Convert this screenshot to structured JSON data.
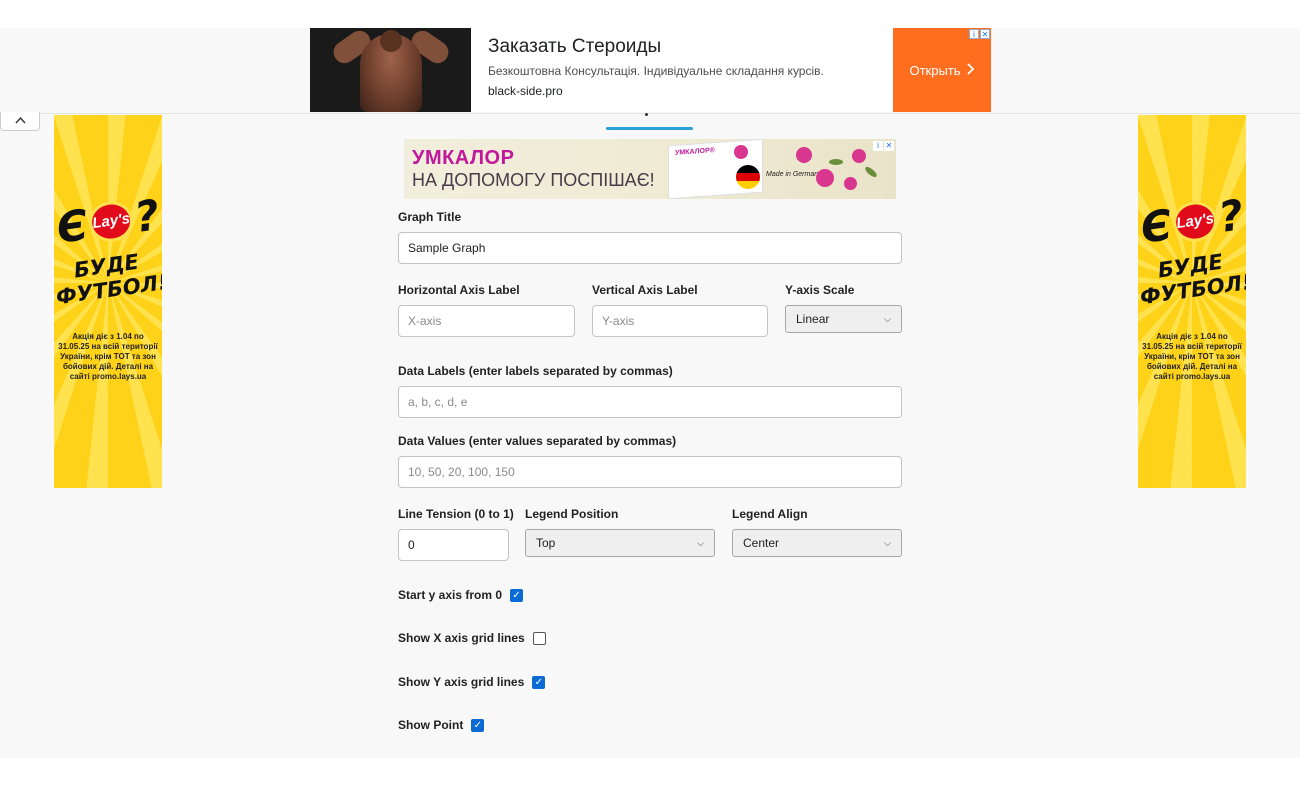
{
  "top_ad": {
    "title": "Заказать Стероиды",
    "description": "Безкоштовна Консультація. Індивідуальне складання курсів.",
    "domain": "black-side.pro",
    "cta": "Открыть",
    "cta_icon": "chevron-right",
    "cta_color": "#ff6d1f"
  },
  "collapse_icon": "^",
  "side_ad": {
    "line1": "Є",
    "brand": "Lay's",
    "q": "?",
    "slogan1": "БУДЕ",
    "slogan2": "ФУТБОЛ!",
    "fine_print": "Акція діє з 1.04 по 31.05.25 на всій території України, крім ТОТ та зон бойових дій. Деталі на сайті promo.lays.ua",
    "bg_color": "#ffd21a"
  },
  "mid_ad": {
    "brand": "УМКАЛОР",
    "tagline": "НА ДОПОМОГУ ПОСПІШАЄ!",
    "box_brand": "УМКАЛОР®",
    "made_in": "Made in Germany"
  },
  "form": {
    "title_label": "Graph Title",
    "title_value": "Sample Graph",
    "x_label": "Horizontal Axis Label",
    "x_placeholder": "X-axis",
    "y_label": "Vertical Axis Label",
    "y_placeholder": "Y-axis",
    "scale_label": "Y-axis Scale",
    "scale_value": "Linear",
    "labels_label": "Data Labels (enter labels separated by commas)",
    "labels_placeholder": "a, b, c, d, e",
    "values_label": "Data Values (enter values separated by commas)",
    "values_placeholder": "10, 50, 20, 100, 150",
    "tension_label": "Line Tension (0 to 1)",
    "tension_value": "0",
    "legend_pos_label": "Legend Position",
    "legend_pos_value": "Top",
    "legend_align_label": "Legend Align",
    "legend_align_value": "Center",
    "checkboxes": [
      {
        "label": "Start y axis from 0",
        "checked": true
      },
      {
        "label": "Show X axis grid lines",
        "checked": false
      },
      {
        "label": "Show Y axis grid lines",
        "checked": true
      },
      {
        "label": "Show Point",
        "checked": true
      }
    ]
  },
  "accent_color": "#2aa0d8",
  "checkbox_color": "#0b6bd3"
}
